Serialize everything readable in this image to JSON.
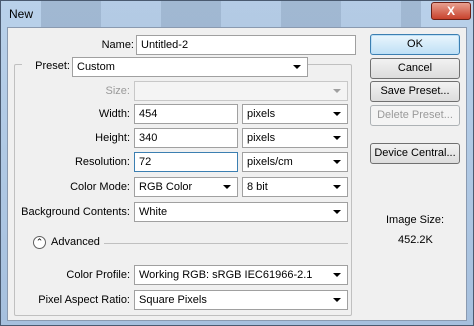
{
  "window": {
    "title": "New",
    "close_glyph": "X"
  },
  "form": {
    "name": {
      "label": "Name:",
      "value": "Untitled-2"
    },
    "preset": {
      "label": "Preset:",
      "value": "Custom"
    },
    "size": {
      "label": "Size:",
      "value": ""
    },
    "width": {
      "label": "Width:",
      "value": "454",
      "unit": "pixels"
    },
    "height": {
      "label": "Height:",
      "value": "340",
      "unit": "pixels"
    },
    "resolution": {
      "label": "Resolution:",
      "value": "72",
      "unit": "pixels/cm"
    },
    "color_mode": {
      "label": "Color Mode:",
      "value": "RGB Color",
      "depth": "8 bit"
    },
    "background": {
      "label": "Background Contents:",
      "value": "White"
    },
    "advanced": {
      "label": "Advanced",
      "icon": "chevron-up-circle-icon"
    },
    "color_profile": {
      "label": "Color Profile:",
      "value": "Working RGB:  sRGB IEC61966-2.1"
    },
    "pixel_aspect": {
      "label": "Pixel Aspect Ratio:",
      "value": "Square Pixels"
    }
  },
  "buttons": {
    "ok": "OK",
    "cancel": "Cancel",
    "save_preset": "Save Preset...",
    "delete_preset": "Delete Preset...",
    "device_central": "Device Central..."
  },
  "info": {
    "image_size_label": "Image Size:",
    "image_size_value": "452.2K"
  }
}
